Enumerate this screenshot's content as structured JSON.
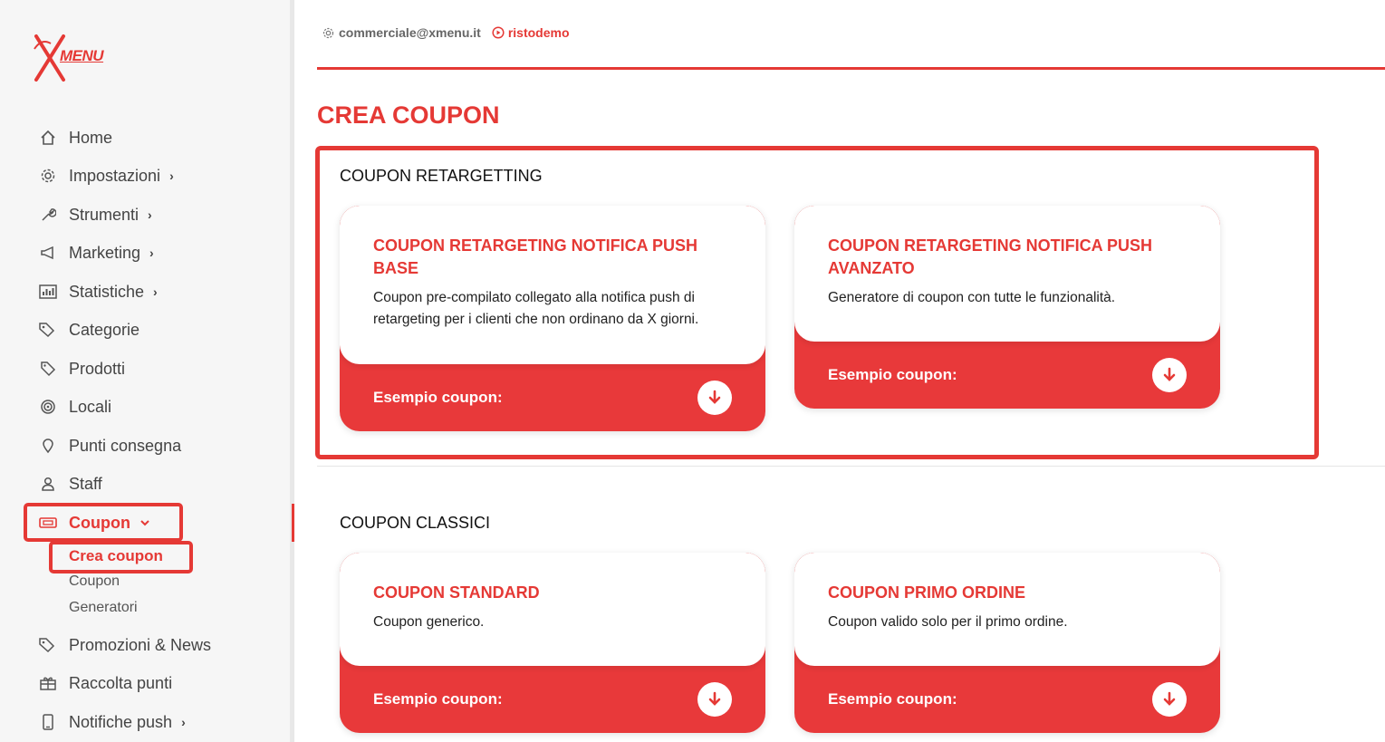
{
  "brand": {
    "logo_text": "MENU",
    "accent": "#e53935"
  },
  "header": {
    "email": "commerciale@xmenu.it",
    "site": "ristodemo"
  },
  "sidebar": {
    "items": [
      {
        "label": "Home",
        "icon": "home-icon"
      },
      {
        "label": "Impostazioni",
        "icon": "gear-icon",
        "chevron": "›"
      },
      {
        "label": "Strumenti",
        "icon": "wrench-icon",
        "chevron": "›"
      },
      {
        "label": "Marketing",
        "icon": "megaphone-icon",
        "chevron": "›"
      },
      {
        "label": "Statistiche",
        "icon": "bar-chart-icon",
        "chevron": "›"
      },
      {
        "label": "Categorie",
        "icon": "tags-icon"
      },
      {
        "label": "Prodotti",
        "icon": "tag-icon"
      },
      {
        "label": "Locali",
        "icon": "target-icon"
      },
      {
        "label": "Punti consegna",
        "icon": "map-pin-icon"
      },
      {
        "label": "Staff",
        "icon": "user-icon"
      },
      {
        "label": "Coupon",
        "icon": "ticket-icon",
        "chevron": "⌄"
      },
      {
        "label": "Promozioni & News",
        "icon": "tags-icon"
      },
      {
        "label": "Raccolta punti",
        "icon": "gift-icon"
      },
      {
        "label": "Notifiche push",
        "icon": "phone-icon",
        "chevron": "›"
      }
    ],
    "sub_items": [
      "Crea coupon",
      "Coupon",
      "Generatori"
    ]
  },
  "main": {
    "title": "CREA COUPON",
    "sections": [
      {
        "title": "COUPON RETARGETTING",
        "cards": [
          {
            "title": "COUPON RETARGETING NOTIFICA PUSH BASE",
            "desc": "Coupon pre-compilato collegato alla notifica push di retargeting per i clienti che non ordinano da X giorni.",
            "footer": "Esempio coupon:"
          },
          {
            "title": "COUPON RETARGETING NOTIFICA PUSH AVANZATO",
            "desc": "Generatore di coupon con tutte le funzionalità.",
            "footer": "Esempio coupon:"
          }
        ]
      },
      {
        "title": "COUPON CLASSICI",
        "cards": [
          {
            "title": "COUPON STANDARD",
            "desc": "Coupon generico.",
            "footer": "Esempio coupon:"
          },
          {
            "title": "COUPON PRIMO ORDINE",
            "desc": "Coupon valido solo per il primo ordine.",
            "footer": "Esempio coupon:"
          }
        ]
      }
    ]
  }
}
